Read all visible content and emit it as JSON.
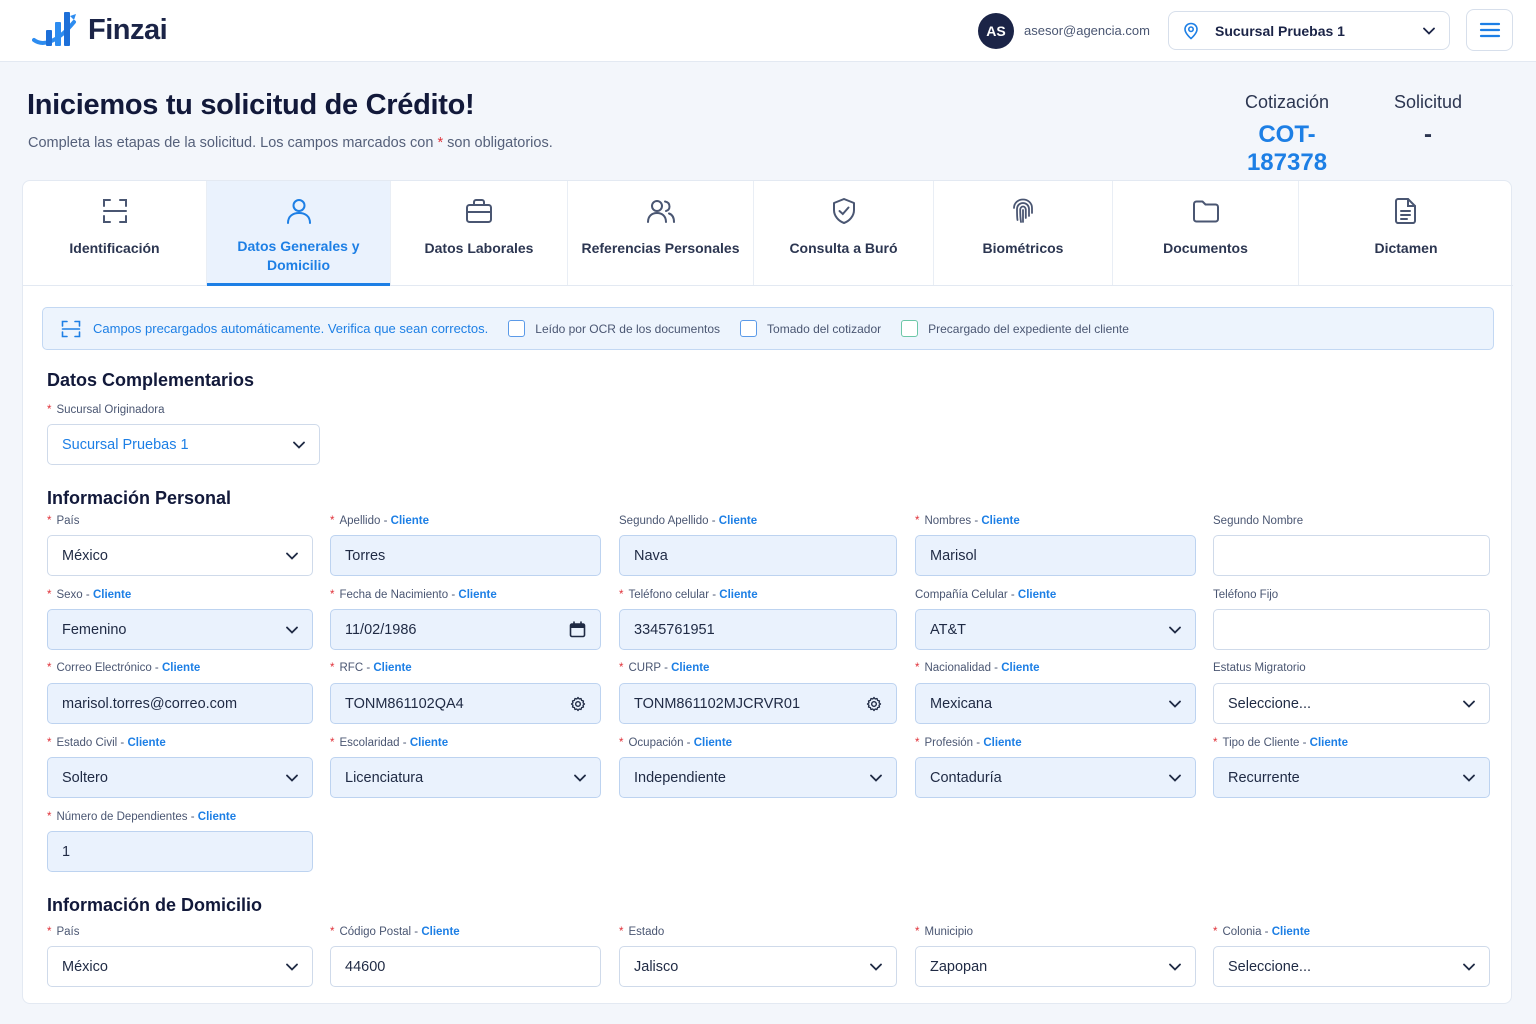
{
  "app": {
    "name": "Finzai"
  },
  "header": {
    "avatar_initials": "AS",
    "user_email": "asesor@agencia.com",
    "branch": "Sucursal Pruebas 1"
  },
  "page": {
    "title": "Iniciemos tu solicitud de Crédito!",
    "subtitle_prefix": "Completa las etapas de la solicitud. Los campos marcados con",
    "subtitle_star": "*",
    "subtitle_suffix": "son obligatorios.",
    "quote_label": "Cotización",
    "quote_value": "COT-187378",
    "solicitud_label": "Solicitud",
    "solicitud_value": "-"
  },
  "tabs": [
    {
      "label": "Identificación",
      "icon": "scan-frame-icon"
    },
    {
      "label": "Datos Generales y Domicilio",
      "icon": "user-icon",
      "active": true
    },
    {
      "label": "Datos Laborales",
      "icon": "briefcase-icon"
    },
    {
      "label": "Referencias Personales",
      "icon": "users-icon"
    },
    {
      "label": "Consulta a Buró",
      "icon": "shield-check-icon"
    },
    {
      "label": "Biométricos",
      "icon": "fingerprint-icon"
    },
    {
      "label": "Documentos",
      "icon": "folder-icon"
    },
    {
      "label": "Dictamen",
      "icon": "document-icon"
    }
  ],
  "notice": {
    "text": "Campos precargados automáticamente. Verifica que sean correctos.",
    "legend": [
      {
        "label": "Leído por OCR de los documentos"
      },
      {
        "label": "Tomado del cotizador"
      },
      {
        "label": "Precargado del expediente del cliente"
      }
    ]
  },
  "source_tag": "Cliente",
  "complementarios": {
    "title": "Datos Complementarios",
    "sucursal": {
      "label": "Sucursal Originadora",
      "value": "Sucursal Pruebas 1"
    }
  },
  "personal": {
    "title": "Información Personal",
    "fields": {
      "pais": {
        "label": "País",
        "value": "México"
      },
      "apellido": {
        "label": "Apellido",
        "value": "Torres"
      },
      "segundo_apellido": {
        "label": "Segundo Apellido",
        "value": "Nava"
      },
      "nombres": {
        "label": "Nombres",
        "value": "Marisol"
      },
      "segundo_nombre": {
        "label": "Segundo Nombre",
        "value": ""
      },
      "sexo": {
        "label": "Sexo",
        "value": "Femenino"
      },
      "fecha_nac": {
        "label": "Fecha de Nacimiento",
        "value": "11/02/1986"
      },
      "tel_celular": {
        "label": "Teléfono celular",
        "value": "3345761951"
      },
      "compania": {
        "label": "Compañía Celular",
        "value": "AT&T"
      },
      "tel_fijo": {
        "label": "Teléfono Fijo",
        "value": ""
      },
      "correo": {
        "label": "Correo Electrónico",
        "value": "marisol.torres@correo.com"
      },
      "rfc": {
        "label": "RFC",
        "value": "TONM861102QA4"
      },
      "curp": {
        "label": "CURP",
        "value": "TONM861102MJCRVR01"
      },
      "nacionalidad": {
        "label": "Nacionalidad",
        "value": "Mexicana"
      },
      "estatus_migratorio": {
        "label": "Estatus Migratorio",
        "value": "Seleccione..."
      },
      "estado_civil": {
        "label": "Estado Civil",
        "value": "Soltero"
      },
      "escolaridad": {
        "label": "Escolaridad",
        "value": "Licenciatura"
      },
      "ocupacion": {
        "label": "Ocupación",
        "value": "Independiente"
      },
      "profesion": {
        "label": "Profesión",
        "value": "Contaduría"
      },
      "tipo_cliente": {
        "label": "Tipo de Cliente",
        "value": "Recurrente"
      },
      "dependientes": {
        "label": "Número de Dependientes",
        "value": "1"
      }
    }
  },
  "domicilio": {
    "title": "Información de Domicilio",
    "fields": {
      "pais": {
        "label": "País",
        "value": "México"
      },
      "cp": {
        "label": "Código Postal",
        "value": "44600"
      },
      "estado": {
        "label": "Estado",
        "value": "Jalisco"
      },
      "municipio": {
        "label": "Municipio",
        "value": "Zapopan"
      },
      "colonia": {
        "label": "Colonia",
        "value": "Seleccione..."
      }
    }
  },
  "colors": {
    "accent": "#1d7fe5",
    "required": "#e0323a",
    "filled_bg": "#eaf2fd",
    "ocr_legend": "#5b9ae8",
    "client_legend": "#6cc7a7"
  }
}
